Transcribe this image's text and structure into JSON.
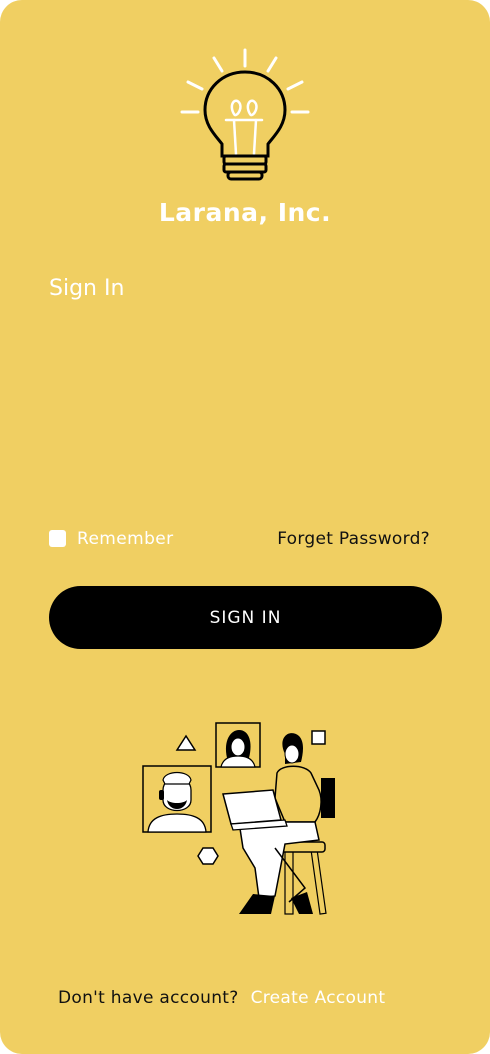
{
  "brand": {
    "name": "Larana, Inc.",
    "logo_icon": "lightbulb-icon"
  },
  "form": {
    "title": "Sign In",
    "remember_label": "Remember",
    "remember_checked": false,
    "forgot_label": "Forget Password?",
    "submit_label": "SIGN IN"
  },
  "illustration": {
    "icon": "remote-meeting-illustration"
  },
  "footer": {
    "question": "Don't have account?",
    "create_label": "Create Account"
  },
  "colors": {
    "background": "#F0CF62",
    "button": "#000000",
    "text_light": "#FFFFFF",
    "text_dark": "#111111"
  }
}
